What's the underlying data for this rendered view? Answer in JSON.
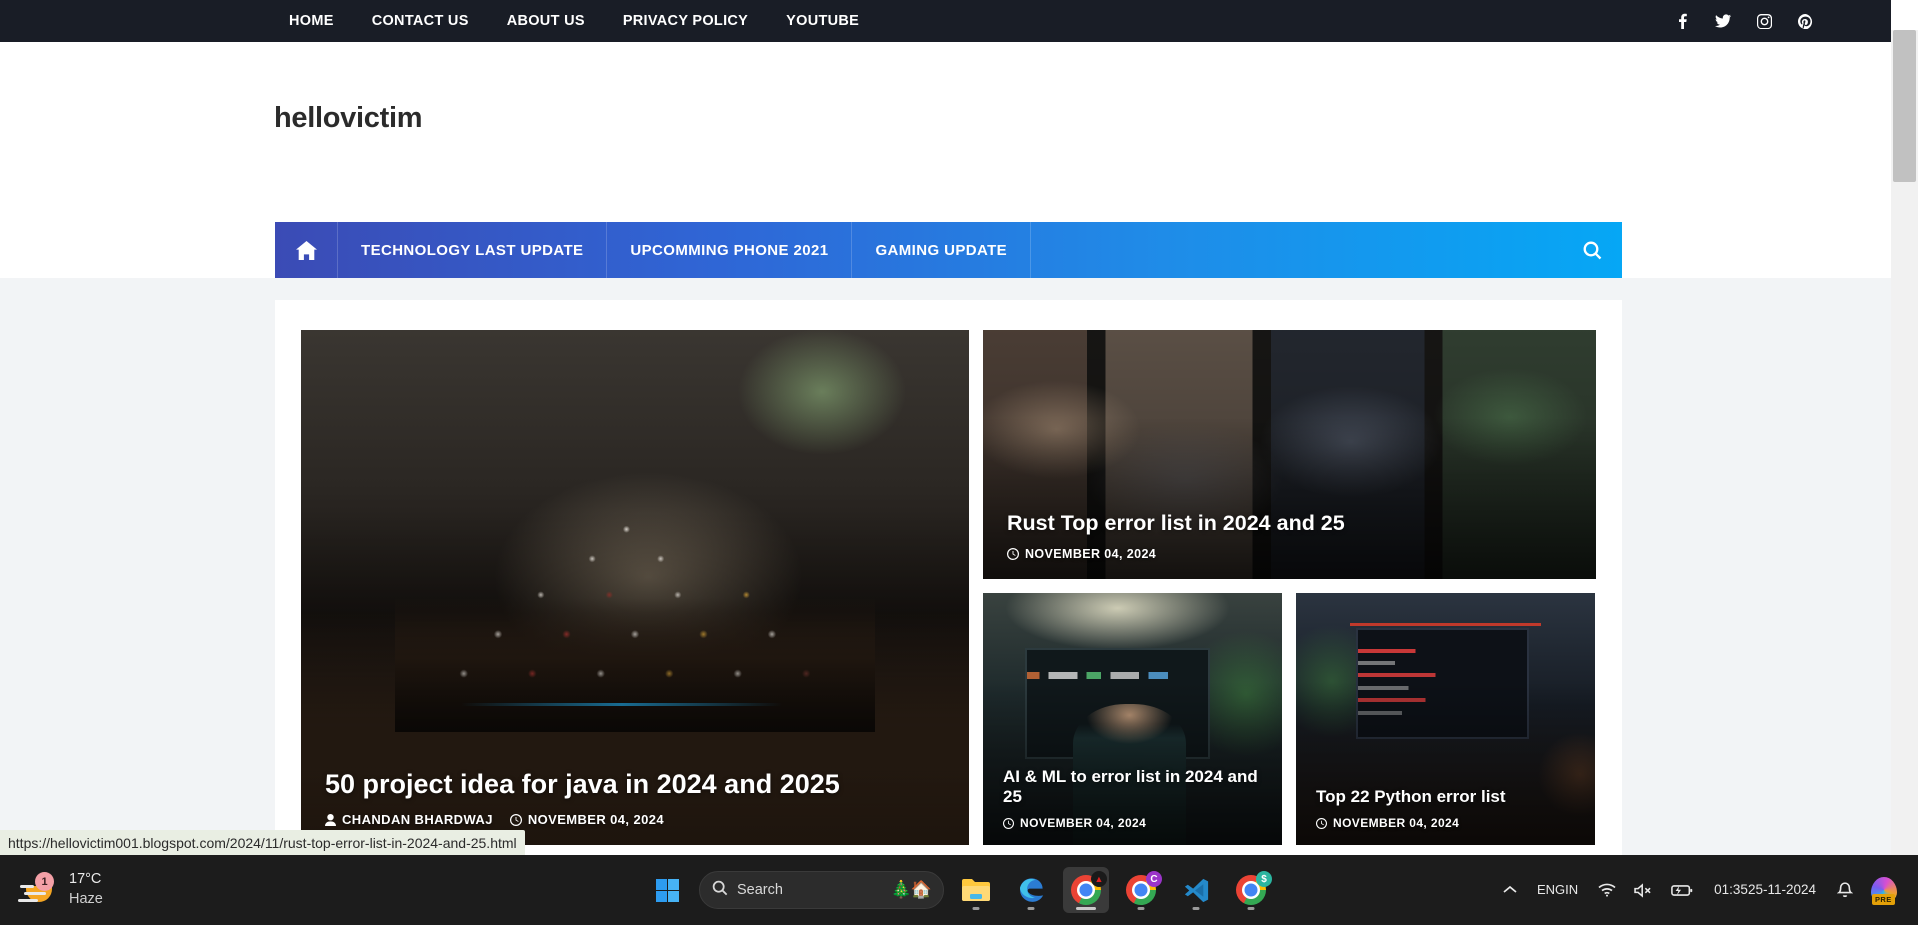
{
  "topbar": {
    "nav_items": [
      {
        "label": "HOME",
        "name": "topnav-home"
      },
      {
        "label": "CONTACT US",
        "name": "topnav-contact-us"
      },
      {
        "label": "ABOUT US",
        "name": "topnav-about-us"
      },
      {
        "label": "PRIVACY POLICY",
        "name": "topnav-privacy-policy"
      },
      {
        "label": "YOUTUBE",
        "name": "topnav-youtube"
      }
    ],
    "social": [
      "facebook-icon",
      "twitter-icon",
      "instagram-icon",
      "pinterest-icon"
    ]
  },
  "site": {
    "title": "hellovictim"
  },
  "mainnav": {
    "home_icon": "home-icon",
    "items": [
      {
        "label": "TECHNOLOGY LAST UPDATE"
      },
      {
        "label": "UPCOMMING PHONE 2021"
      },
      {
        "label": "GAMING UPDATE"
      }
    ],
    "search_icon": "search-icon",
    "gradient_start": "#3b4bb5",
    "gradient_end": "#06a7f5"
  },
  "posts": {
    "featured": {
      "title": "50 project idea for java in 2024 and 2025",
      "author": "CHANDAN BHARDWAJ",
      "date": "NOVEMBER 04, 2024"
    },
    "rust": {
      "title": "Rust Top error list in 2024 and 25",
      "date": "NOVEMBER 04, 2024"
    },
    "aiml": {
      "title": "AI & ML to error list in 2024 and 25",
      "date": "NOVEMBER 04, 2024"
    },
    "python": {
      "title": "Top 22 Python error list",
      "date": "NOVEMBER 04, 2024"
    }
  },
  "status": {
    "url": "https://hellovictim001.blogspot.com/2024/11/rust-top-error-list-in-2024-and-25.html"
  },
  "taskbar": {
    "weather": {
      "temperature": "17°C",
      "condition": "Haze",
      "badge": "1"
    },
    "start": "windows-start-icon",
    "search": {
      "placeholder": "Search",
      "emoji": "🎄🏠"
    },
    "apps": [
      {
        "name": "file-explorer",
        "label": "File Explorer"
      },
      {
        "name": "microsoft-edge",
        "label": "Microsoft Edge"
      },
      {
        "name": "google-chrome-active",
        "label": "Google Chrome"
      },
      {
        "name": "google-chrome-profile-c",
        "label": "Google Chrome",
        "badge": "C"
      },
      {
        "name": "visual-studio-code",
        "label": "Visual Studio Code"
      },
      {
        "name": "google-chrome-profile-s",
        "label": "Google Chrome",
        "badge": "$"
      }
    ],
    "tray": {
      "chevron": "chevron-up-icon",
      "language_primary": "ENG",
      "language_secondary": "IN",
      "wifi": "wifi-icon",
      "volume": "volume-muted-icon",
      "battery": "battery-charging-icon",
      "time": "01:35",
      "date": "25-11-2024",
      "notifications": "bell-icon",
      "copilot": "copilot-icon",
      "copilot_badge": "PRE"
    }
  }
}
